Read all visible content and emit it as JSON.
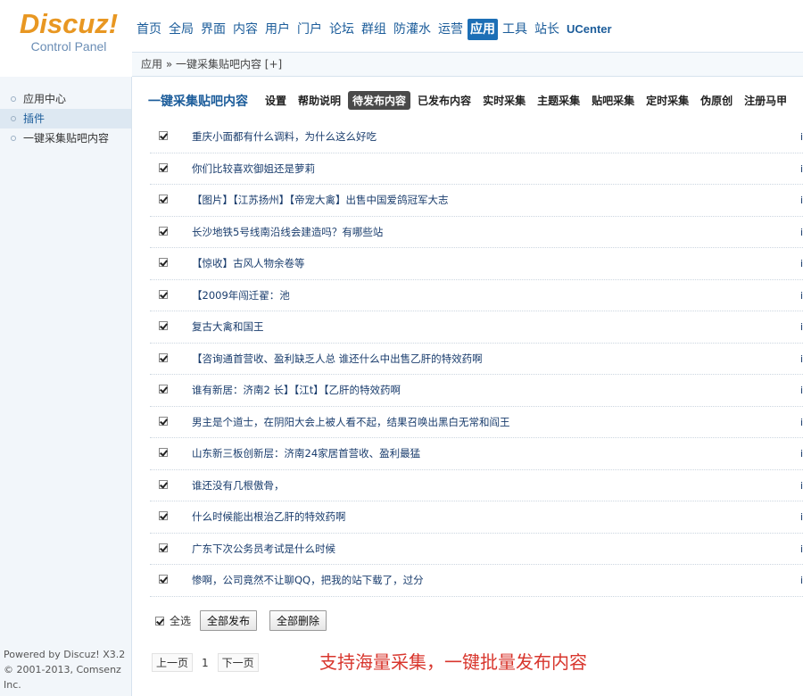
{
  "logo": {
    "main": "Discuz!",
    "sub": "Control Panel"
  },
  "topnav": [
    {
      "label": "首页",
      "active": false
    },
    {
      "label": "全局",
      "active": false
    },
    {
      "label": "界面",
      "active": false
    },
    {
      "label": "内容",
      "active": false
    },
    {
      "label": "用户",
      "active": false
    },
    {
      "label": "门户",
      "active": false
    },
    {
      "label": "论坛",
      "active": false
    },
    {
      "label": "群组",
      "active": false
    },
    {
      "label": "防灌水",
      "active": false
    },
    {
      "label": "运营",
      "active": false
    },
    {
      "label": "应用",
      "active": true
    },
    {
      "label": "工具",
      "active": false
    },
    {
      "label": "站长",
      "active": false
    },
    {
      "label": "UCenter",
      "active": false
    }
  ],
  "breadcrumb": "应用 » 一键采集贴吧内容 [+]",
  "sidebar": {
    "items": [
      {
        "label": "应用中心",
        "active": false
      },
      {
        "label": "插件",
        "active": true
      },
      {
        "label": "一键采集贴吧内容",
        "active": false
      }
    ],
    "footer_line1": "Powered by Discuz! X3.2",
    "footer_line2": "© 2001-2013, Comsenz Inc."
  },
  "subnav": {
    "title": "一键采集贴吧内容",
    "tabs": [
      {
        "label": "设置",
        "active": false
      },
      {
        "label": "帮助说明",
        "active": false
      },
      {
        "label": "待发布内容",
        "active": true
      },
      {
        "label": "已发布内容",
        "active": false
      },
      {
        "label": "实时采集",
        "active": false
      },
      {
        "label": "主题采集",
        "active": false
      },
      {
        "label": "贴吧采集",
        "active": false
      },
      {
        "label": "定时采集",
        "active": false
      },
      {
        "label": "伪原创",
        "active": false
      },
      {
        "label": "注册马甲",
        "active": false
      }
    ]
  },
  "rows": [
    {
      "title": "重庆小面都有什么调料，为什么这么好吃",
      "edge": "i"
    },
    {
      "title": "你们比较喜欢御姐还是萝莉",
      "edge": "i"
    },
    {
      "title": "【图片】【江苏扬州】【帝宠大禽】出售中国爱鸽冠军大志",
      "edge": "i"
    },
    {
      "title": "长沙地铁5号线南沿线会建造吗？有哪些站",
      "edge": "i"
    },
    {
      "title": "【惊收】古风人物余卷等",
      "edge": "i"
    },
    {
      "title": "【2009年闯迁翟：池",
      "edge": "i"
    },
    {
      "title": "复古大禽和国王",
      "edge": "i"
    },
    {
      "title": "【咨询通首营收、盈利缺乏人总              谁还什么中出售乙肝的特效药啊",
      "edge": "i"
    },
    {
      "title": "谁有新居：济南2                           长】【江t】【乙肝的特效药啊",
      "edge": "i"
    },
    {
      "title": "男主是个道士，在阴阳大会上被人看不起，结果召唤出黑白无常和阎王",
      "edge": "i"
    },
    {
      "title": "山东新三板创新层：济南24家居首营收、盈利最猛",
      "edge": "i"
    },
    {
      "title": "谁还没有几根傲骨，",
      "edge": "i"
    },
    {
      "title": "什么时候能出根治乙肝的特效药啊",
      "edge": "i"
    },
    {
      "title": "广东下次公务员考试是什么时候",
      "edge": "i"
    },
    {
      "title": "惨啊，公司竟然不让聊QQ，把我的站下载了，过分",
      "edge": "i"
    }
  ],
  "actions": {
    "select_all": "全选",
    "publish_all": "全部发布",
    "delete_all": "全部删除"
  },
  "pager": {
    "prev": "上一页",
    "current": "1",
    "next": "下一页"
  },
  "promo": "支持海量采集，一键批量发布内容"
}
